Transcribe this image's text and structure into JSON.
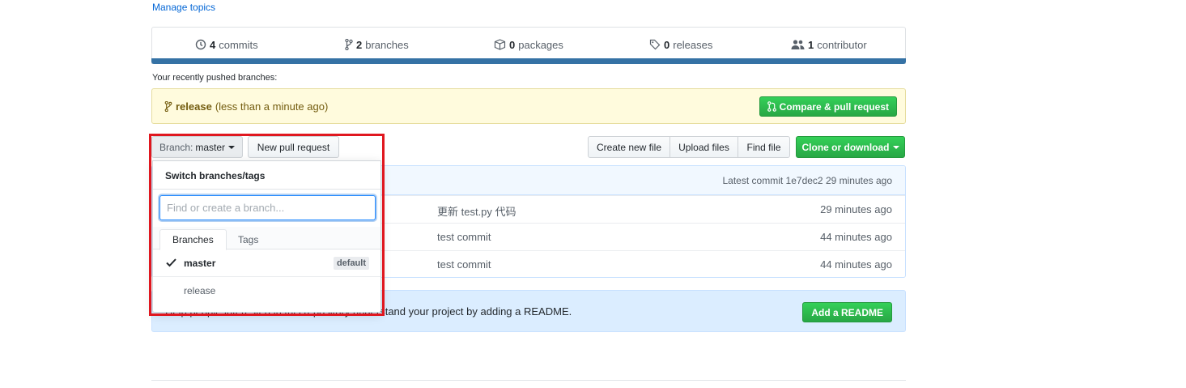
{
  "topics": {
    "manage_label": "Manage topics"
  },
  "summary": {
    "commits": {
      "count": "4",
      "label": "commits"
    },
    "branches": {
      "count": "2",
      "label": "branches"
    },
    "packages": {
      "count": "0",
      "label": "packages"
    },
    "releases": {
      "count": "0",
      "label": "releases"
    },
    "contributors": {
      "count": "1",
      "label": "contributor"
    },
    "language_color": "#3572a5"
  },
  "recent": {
    "label": "Your recently pushed branches:",
    "branch": "release",
    "time": "(less than a minute ago)",
    "compare_label": "Compare & pull request"
  },
  "toolbar": {
    "branch_label": "Branch:",
    "branch_value": "master",
    "new_pr_label": "New pull request",
    "create_file_label": "Create new file",
    "upload_label": "Upload files",
    "find_label": "Find file",
    "clone_label": "Clone or download"
  },
  "commit_tease": {
    "prefix": "Latest commit",
    "sha": "1e7dec2",
    "age": "29 minutes ago"
  },
  "files": [
    {
      "message": "更新 test.py 代码",
      "age": "29 minutes ago"
    },
    {
      "message": "test commit",
      "age": "44 minutes ago"
    },
    {
      "message": "test commit",
      "age": "44 minutes ago"
    }
  ],
  "readme": {
    "text": "Help people interested in this repository understand your project by adding a README.",
    "button_label": "Add a README"
  },
  "dropdown": {
    "title": "Switch branches/tags",
    "filter_placeholder": "Find or create a branch...",
    "tabs": [
      "Branches",
      "Tags"
    ],
    "items": [
      {
        "name": "master",
        "badge": "default",
        "selected": true
      },
      {
        "name": "release",
        "badge": "",
        "selected": false
      }
    ]
  },
  "colors": {
    "accent_green": "#28a745",
    "link_blue": "#0366d6",
    "highlight_red": "#e0171f"
  }
}
